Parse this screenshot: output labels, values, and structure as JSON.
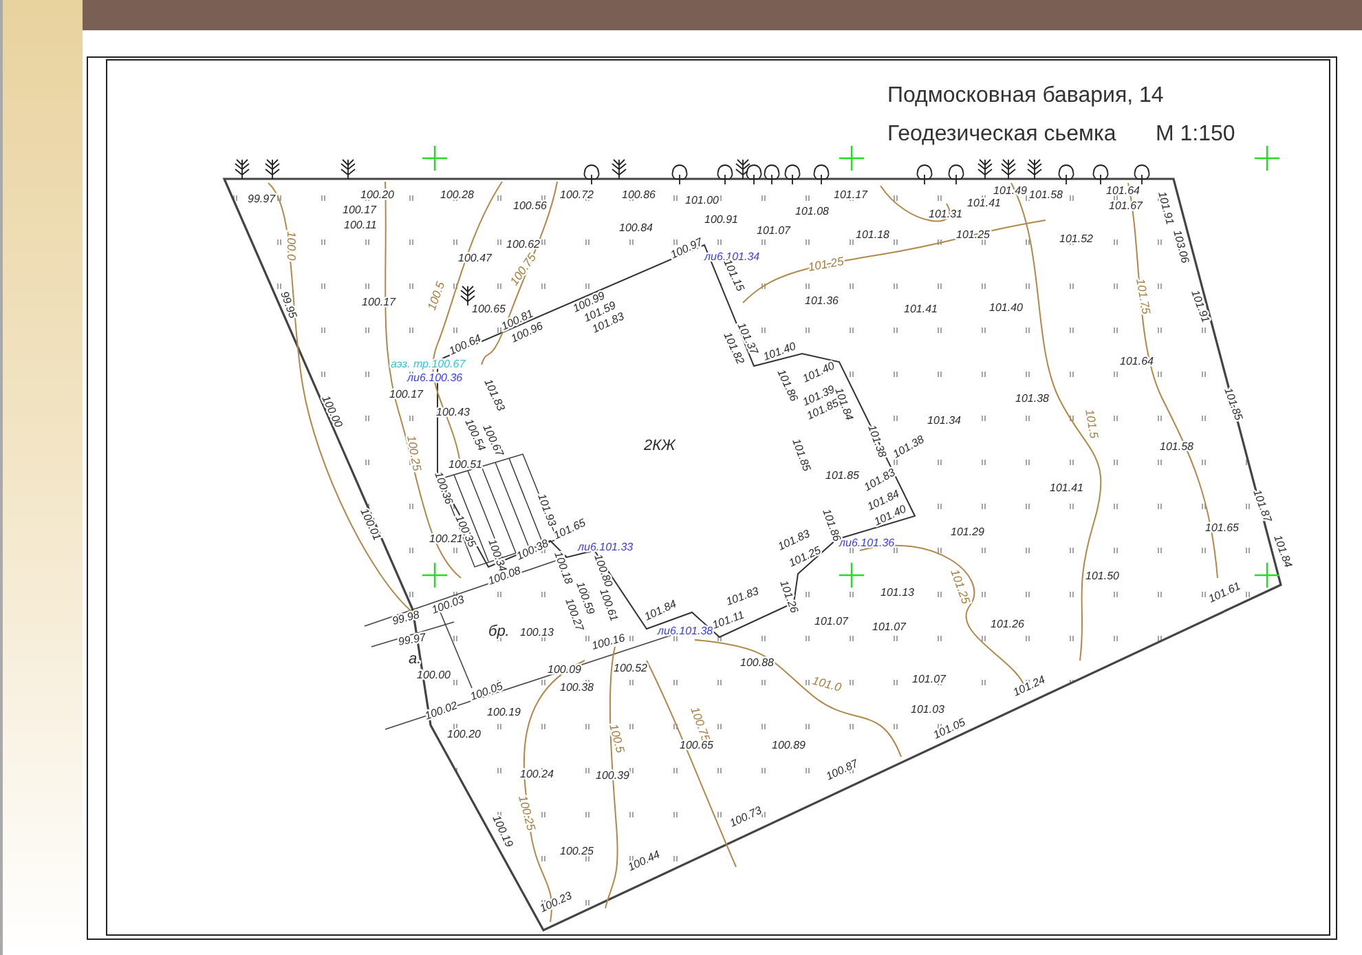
{
  "drawing": {
    "title": "Подмосковная бавария, 14",
    "subtitle": "Геодезическая сьемка",
    "scale": "М 1:150",
    "labels": [
      {
        "text": "99.97",
        "kind": "spot"
      },
      {
        "text": "100.20",
        "kind": "spot"
      },
      {
        "text": "100.28",
        "kind": "spot"
      },
      {
        "text": "100.17",
        "kind": "spot"
      },
      {
        "text": "100.11",
        "kind": "spot"
      },
      {
        "text": "100.56",
        "kind": "spot"
      },
      {
        "text": "100.62",
        "kind": "spot"
      },
      {
        "text": "100.47",
        "kind": "spot"
      },
      {
        "text": "100.17",
        "kind": "spot"
      },
      {
        "text": "100.65",
        "kind": "spot"
      },
      {
        "text": "100.64",
        "kind": "spot"
      },
      {
        "text": "100.81",
        "kind": "spot"
      },
      {
        "text": "100.96",
        "kind": "spot"
      },
      {
        "text": "аэз. тр.100.67",
        "kind": "pipe"
      },
      {
        "text": "ли6.100.36",
        "kind": "note"
      },
      {
        "text": "101.83",
        "kind": "spot"
      },
      {
        "text": "100.17",
        "kind": "spot"
      },
      {
        "text": "100.43",
        "kind": "spot"
      },
      {
        "text": "100.54",
        "kind": "spot"
      },
      {
        "text": "100.67",
        "kind": "spot"
      },
      {
        "text": "100.51",
        "kind": "spot"
      },
      {
        "text": "100.36",
        "kind": "spot"
      },
      {
        "text": "100.35",
        "kind": "spot"
      },
      {
        "text": "101.93",
        "kind": "spot"
      },
      {
        "text": "100.21",
        "kind": "spot"
      },
      {
        "text": "100.0",
        "kind": "contour"
      },
      {
        "text": "99.95",
        "kind": "spot"
      },
      {
        "text": "100.00",
        "kind": "spot"
      },
      {
        "text": "100.01",
        "kind": "spot"
      },
      {
        "text": "100.5",
        "kind": "contour"
      },
      {
        "text": "100.75",
        "kind": "contour"
      },
      {
        "text": "100.25",
        "kind": "contour"
      },
      {
        "text": "100.72",
        "kind": "spot"
      },
      {
        "text": "100.86",
        "kind": "spot"
      },
      {
        "text": "101.00",
        "kind": "spot"
      },
      {
        "text": "100.84",
        "kind": "spot"
      },
      {
        "text": "100.91",
        "kind": "spot"
      },
      {
        "text": "101.07",
        "kind": "spot"
      },
      {
        "text": "101.08",
        "kind": "spot"
      },
      {
        "text": "101.17",
        "kind": "spot"
      },
      {
        "text": "101.18",
        "kind": "spot"
      },
      {
        "text": "100.97",
        "kind": "spot"
      },
      {
        "text": "ли6.101.34",
        "kind": "note"
      },
      {
        "text": "101.25",
        "kind": "contour"
      },
      {
        "text": "101.36",
        "kind": "spot"
      },
      {
        "text": "100.99",
        "kind": "spot"
      },
      {
        "text": "101.59",
        "kind": "spot"
      },
      {
        "text": "101.83",
        "kind": "spot"
      },
      {
        "text": "101.15",
        "kind": "spot"
      },
      {
        "text": "101.37",
        "kind": "spot"
      },
      {
        "text": "101.82",
        "kind": "spot"
      },
      {
        "text": "101.40",
        "kind": "spot"
      },
      {
        "text": "101.40",
        "kind": "spot"
      },
      {
        "text": "101.86",
        "kind": "spot"
      },
      {
        "text": "101.39",
        "kind": "spot"
      },
      {
        "text": "101.85",
        "kind": "spot"
      },
      {
        "text": "101.84",
        "kind": "spot"
      },
      {
        "text": "101.38",
        "kind": "spot"
      },
      {
        "text": "101.85",
        "kind": "spot"
      },
      {
        "text": "2КЖ",
        "kind": "name"
      },
      {
        "text": "101.85",
        "kind": "spot"
      },
      {
        "text": "101.38",
        "kind": "spot"
      },
      {
        "text": "101.83",
        "kind": "spot"
      },
      {
        "text": "101.84",
        "kind": "spot"
      },
      {
        "text": "101.40",
        "kind": "spot"
      },
      {
        "text": "101.86",
        "kind": "spot"
      },
      {
        "text": "101.65",
        "kind": "spot"
      },
      {
        "text": "ли6.101.33",
        "kind": "note"
      },
      {
        "text": "ли6.101.36",
        "kind": "note"
      },
      {
        "text": "101.41",
        "kind": "spot"
      },
      {
        "text": "101.49",
        "kind": "spot"
      },
      {
        "text": "101.58",
        "kind": "spot"
      },
      {
        "text": "101.64",
        "kind": "spot"
      },
      {
        "text": "101.67",
        "kind": "spot"
      },
      {
        "text": "101.31",
        "kind": "spot"
      },
      {
        "text": "101.25",
        "kind": "spot"
      },
      {
        "text": "101.52",
        "kind": "spot"
      },
      {
        "text": "101.91",
        "kind": "spot"
      },
      {
        "text": "103.06",
        "kind": "spot"
      },
      {
        "text": "101.91",
        "kind": "spot"
      },
      {
        "text": "101.75",
        "kind": "contour"
      },
      {
        "text": "101.41",
        "kind": "spot"
      },
      {
        "text": "101.40",
        "kind": "spot"
      },
      {
        "text": "101.64",
        "kind": "spot"
      },
      {
        "text": "101.38",
        "kind": "spot"
      },
      {
        "text": "101.34",
        "kind": "spot"
      },
      {
        "text": "101.5",
        "kind": "contour"
      },
      {
        "text": "101.85",
        "kind": "spot"
      },
      {
        "text": "101.58",
        "kind": "spot"
      },
      {
        "text": "101.41",
        "kind": "spot"
      },
      {
        "text": "101.29",
        "kind": "spot"
      },
      {
        "text": "101.65",
        "kind": "spot"
      },
      {
        "text": "101.87",
        "kind": "spot"
      },
      {
        "text": "101.84",
        "kind": "spot"
      },
      {
        "text": "101.50",
        "kind": "spot"
      },
      {
        "text": "101.25",
        "kind": "contour"
      },
      {
        "text": "101.61",
        "kind": "spot"
      },
      {
        "text": "100.34",
        "kind": "spot"
      },
      {
        "text": "100.08",
        "kind": "spot"
      },
      {
        "text": "100.38",
        "kind": "spot"
      },
      {
        "text": "100.18",
        "kind": "spot"
      },
      {
        "text": "100.80",
        "kind": "spot"
      },
      {
        "text": "100.59",
        "kind": "spot"
      },
      {
        "text": "100.61",
        "kind": "spot"
      },
      {
        "text": "100.27",
        "kind": "spot"
      },
      {
        "text": "99.98",
        "kind": "spot"
      },
      {
        "text": "100.03",
        "kind": "spot"
      },
      {
        "text": "бр.",
        "kind": "name"
      },
      {
        "text": "100.13",
        "kind": "spot"
      },
      {
        "text": "99.97",
        "kind": "spot"
      },
      {
        "text": "а.",
        "kind": "name"
      },
      {
        "text": "100.00",
        "kind": "spot"
      },
      {
        "text": "100.02",
        "kind": "spot"
      },
      {
        "text": "100.05",
        "kind": "spot"
      },
      {
        "text": "100.16",
        "kind": "spot"
      },
      {
        "text": "100.52",
        "kind": "spot"
      },
      {
        "text": "100.09",
        "kind": "spot"
      },
      {
        "text": "100.38",
        "kind": "spot"
      },
      {
        "text": "100.19",
        "kind": "spot"
      },
      {
        "text": "100.20",
        "kind": "spot"
      },
      {
        "text": "100.24",
        "kind": "spot"
      },
      {
        "text": "100.39",
        "kind": "spot"
      },
      {
        "text": "100.5",
        "kind": "contour"
      },
      {
        "text": "100.25",
        "kind": "contour"
      },
      {
        "text": "100.19",
        "kind": "spot"
      },
      {
        "text": "100.25",
        "kind": "spot"
      },
      {
        "text": "100.44",
        "kind": "spot"
      },
      {
        "text": "100.23",
        "kind": "spot"
      },
      {
        "text": "101.84",
        "kind": "spot"
      },
      {
        "text": "ли6.101.38",
        "kind": "note"
      },
      {
        "text": "101.83",
        "kind": "spot"
      },
      {
        "text": "101.25",
        "kind": "spot"
      },
      {
        "text": "101.26",
        "kind": "spot"
      },
      {
        "text": "101.83",
        "kind": "spot"
      },
      {
        "text": "101.11",
        "kind": "spot"
      },
      {
        "text": "101.13",
        "kind": "spot"
      },
      {
        "text": "101.07",
        "kind": "spot"
      },
      {
        "text": "101.07",
        "kind": "spot"
      },
      {
        "text": "101.26",
        "kind": "spot"
      },
      {
        "text": "101.0",
        "kind": "contour"
      },
      {
        "text": "100.88",
        "kind": "spot"
      },
      {
        "text": "101.07",
        "kind": "spot"
      },
      {
        "text": "101.03",
        "kind": "spot"
      },
      {
        "text": "100.75",
        "kind": "contour"
      },
      {
        "text": "100.65",
        "kind": "spot"
      },
      {
        "text": "100.89",
        "kind": "spot"
      },
      {
        "text": "101.05",
        "kind": "spot"
      },
      {
        "text": "101.24",
        "kind": "spot"
      },
      {
        "text": "100.87",
        "kind": "spot"
      },
      {
        "text": "100.73",
        "kind": "spot"
      }
    ]
  }
}
